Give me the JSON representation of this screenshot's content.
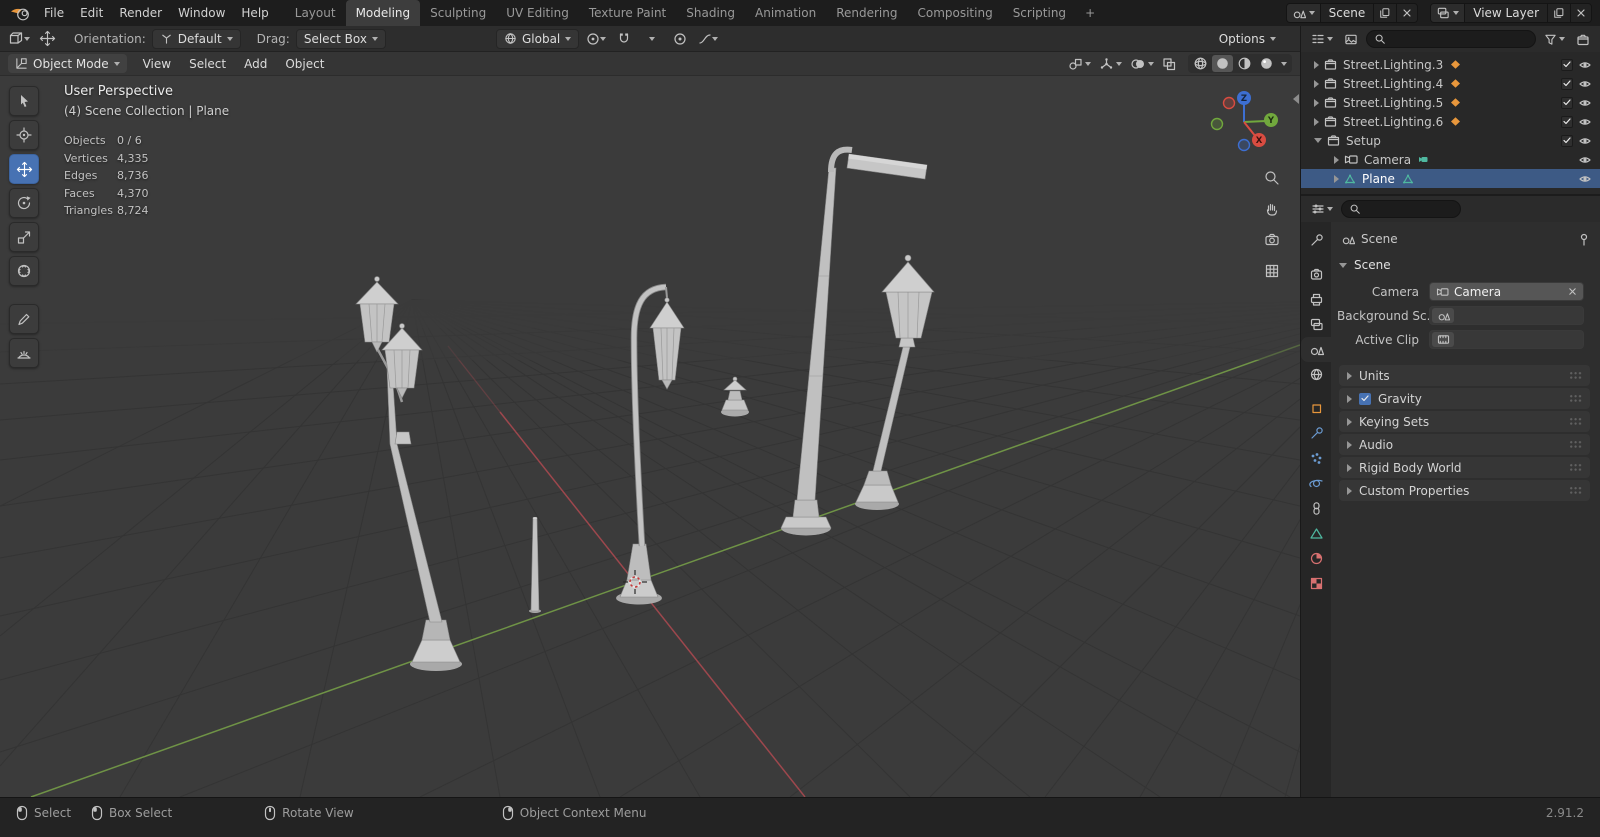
{
  "topbar": {
    "menus": [
      "File",
      "Edit",
      "Render",
      "Window",
      "Help"
    ],
    "workspaces": [
      "Layout",
      "Modeling",
      "Sculpting",
      "UV Editing",
      "Texture Paint",
      "Shading",
      "Animation",
      "Rendering",
      "Compositing",
      "Scripting"
    ],
    "active_workspace": "Modeling",
    "add_workspace": "+",
    "scene_selector": "Scene",
    "view_layer_selector": "View Layer"
  },
  "tool_settings": {
    "orientation_label": "Orientation:",
    "orientation_value": "Default",
    "drag_label": "Drag:",
    "drag_value": "Select Box",
    "transform_orientation": "Global",
    "options_label": "Options"
  },
  "viewport": {
    "mode": "Object Mode",
    "menus": [
      "View",
      "Select",
      "Add",
      "Object"
    ],
    "overlay": {
      "view_label": "User Perspective",
      "context_label": "(4) Scene Collection | Plane",
      "stats": [
        {
          "label": "Objects",
          "value": "0 / 6"
        },
        {
          "label": "Vertices",
          "value": "4,335"
        },
        {
          "label": "Edges",
          "value": "8,736"
        },
        {
          "label": "Faces",
          "value": "4,370"
        },
        {
          "label": "Triangles",
          "value": "8,724"
        }
      ]
    },
    "axis_labels": {
      "x": "X",
      "y": "Y",
      "z": "Z"
    }
  },
  "outliner": {
    "items": [
      {
        "label": "Street.Lighting.3"
      },
      {
        "label": "Street.Lighting.4"
      },
      {
        "label": "Street.Lighting.5"
      },
      {
        "label": "Street.Lighting.6"
      },
      {
        "label": "Setup"
      },
      {
        "label": "Camera"
      },
      {
        "label": "Plane"
      }
    ]
  },
  "properties": {
    "breadcrumb": "Scene",
    "section_title": "Scene",
    "fields": [
      {
        "label": "Camera",
        "value": "Camera"
      },
      {
        "label": "Background Sc...",
        "value": ""
      },
      {
        "label": "Active Clip",
        "value": ""
      }
    ],
    "panels": [
      "Units",
      "Gravity",
      "Keying Sets",
      "Audio",
      "Rigid Body World",
      "Custom Properties"
    ]
  },
  "statusbar": {
    "hints": [
      "Select",
      "Box Select",
      "Rotate View",
      "Object Context Menu"
    ],
    "version": "2.91.2"
  },
  "colors": {
    "accent": "#4772b3",
    "axis_x": "#a8494f",
    "axis_y": "#6f9346",
    "axis_z": "#3d6fd2",
    "selection": "#3d5a85",
    "object_orange": "#e8973c",
    "data_green": "#4fb8a0"
  }
}
